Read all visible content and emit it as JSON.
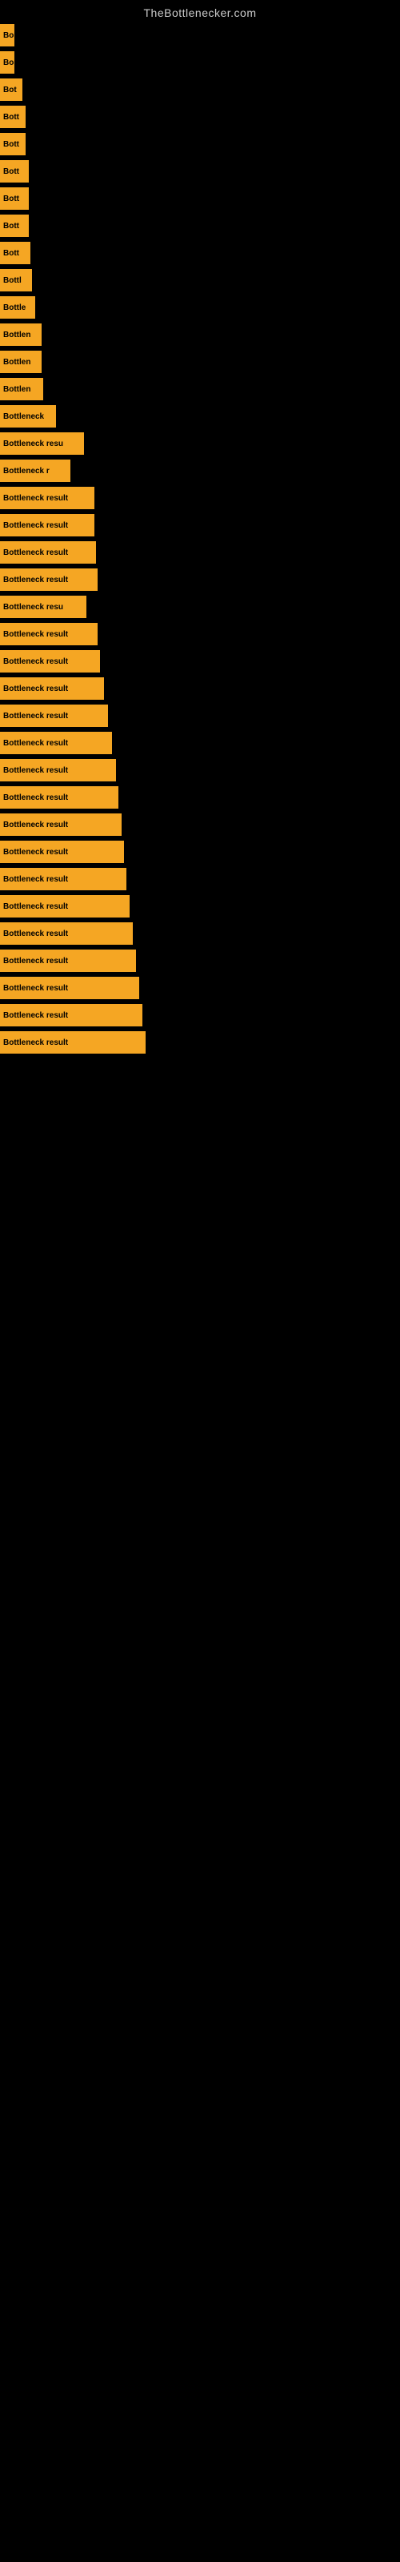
{
  "site_title": "TheBottlenecker.com",
  "bars": [
    {
      "label": "Bo",
      "width": 18
    },
    {
      "label": "Bo",
      "width": 18
    },
    {
      "label": "Bot",
      "width": 28
    },
    {
      "label": "Bott",
      "width": 32
    },
    {
      "label": "Bott",
      "width": 32
    },
    {
      "label": "Bott",
      "width": 36
    },
    {
      "label": "Bott",
      "width": 36
    },
    {
      "label": "Bott",
      "width": 36
    },
    {
      "label": "Bott",
      "width": 38
    },
    {
      "label": "Bottl",
      "width": 40
    },
    {
      "label": "Bottle",
      "width": 44
    },
    {
      "label": "Bottlen",
      "width": 52
    },
    {
      "label": "Bottlen",
      "width": 52
    },
    {
      "label": "Bottlen",
      "width": 54
    },
    {
      "label": "Bottleneck",
      "width": 70
    },
    {
      "label": "Bottleneck resu",
      "width": 105
    },
    {
      "label": "Bottleneck r",
      "width": 88
    },
    {
      "label": "Bottleneck result",
      "width": 118
    },
    {
      "label": "Bottleneck result",
      "width": 118
    },
    {
      "label": "Bottleneck result",
      "width": 120
    },
    {
      "label": "Bottleneck result",
      "width": 122
    },
    {
      "label": "Bottleneck resu",
      "width": 108
    },
    {
      "label": "Bottleneck result",
      "width": 122
    },
    {
      "label": "Bottleneck result",
      "width": 125
    },
    {
      "label": "Bottleneck result",
      "width": 130
    },
    {
      "label": "Bottleneck result",
      "width": 135
    },
    {
      "label": "Bottleneck result",
      "width": 140
    },
    {
      "label": "Bottleneck result",
      "width": 145
    },
    {
      "label": "Bottleneck result",
      "width": 148
    },
    {
      "label": "Bottleneck result",
      "width": 152
    },
    {
      "label": "Bottleneck result",
      "width": 155
    },
    {
      "label": "Bottleneck result",
      "width": 158
    },
    {
      "label": "Bottleneck result",
      "width": 162
    },
    {
      "label": "Bottleneck result",
      "width": 166
    },
    {
      "label": "Bottleneck result",
      "width": 170
    },
    {
      "label": "Bottleneck result",
      "width": 174
    },
    {
      "label": "Bottleneck result",
      "width": 178
    },
    {
      "label": "Bottleneck result",
      "width": 182
    }
  ]
}
